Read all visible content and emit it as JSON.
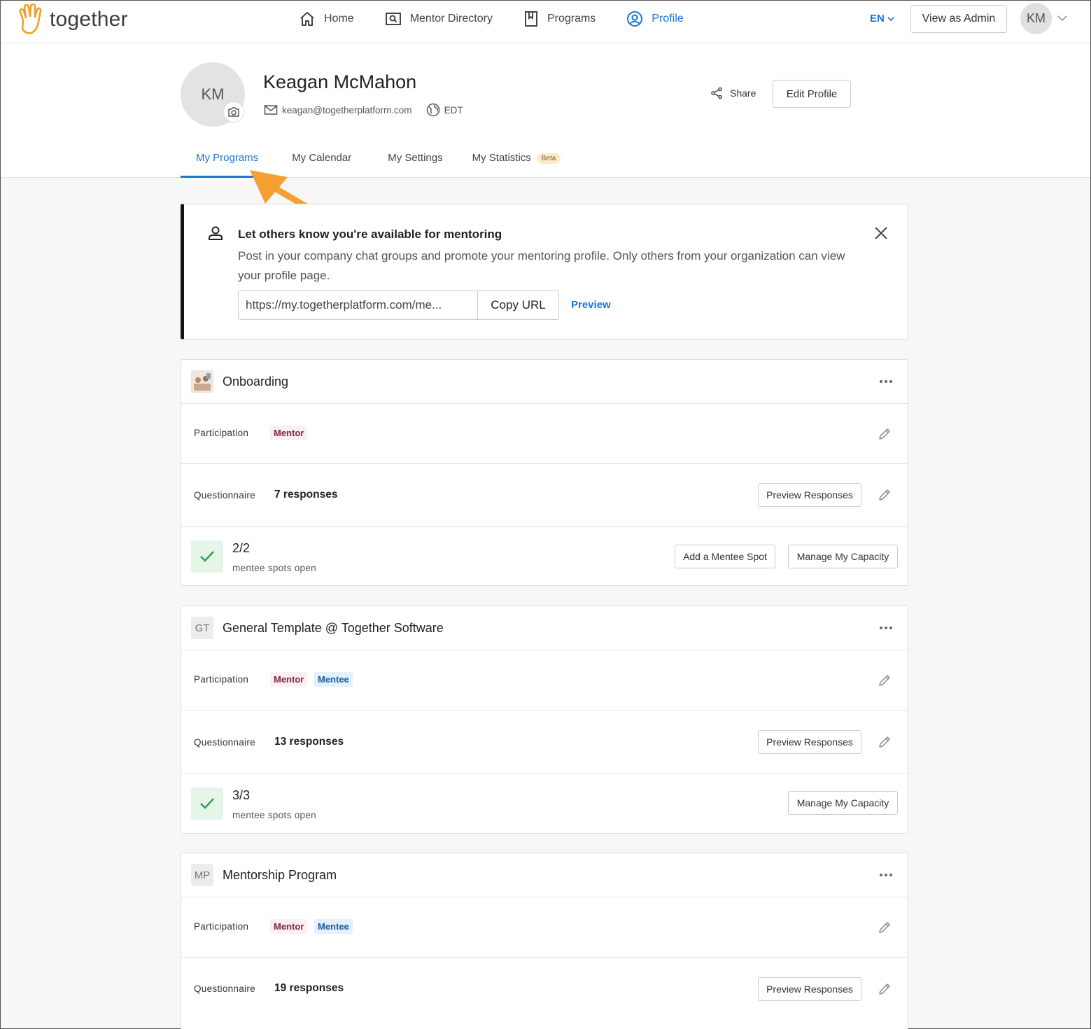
{
  "brand": {
    "name": "together",
    "accent": "#1976d2",
    "logo_color": "#f0a030"
  },
  "nav": {
    "items": [
      {
        "label": "Home",
        "icon": "home-icon",
        "active": false
      },
      {
        "label": "Mentor Directory",
        "icon": "directory-icon",
        "active": false
      },
      {
        "label": "Programs",
        "icon": "bookmark-icon",
        "active": false
      },
      {
        "label": "Profile",
        "icon": "user-circle-icon",
        "active": true
      }
    ],
    "language": "EN",
    "admin_button": "View as Admin",
    "avatar_initials": "KM"
  },
  "profile": {
    "initials": "KM",
    "name": "Keagan McMahon",
    "email": "keagan@togetherplatform.com",
    "timezone": "EDT",
    "share_label": "Share",
    "edit_label": "Edit Profile"
  },
  "tabs": [
    {
      "label": "My Programs",
      "active": true
    },
    {
      "label": "My Calendar",
      "active": false
    },
    {
      "label": "My Settings",
      "active": false
    },
    {
      "label": "My Statistics",
      "active": false,
      "badge": "Beta"
    }
  ],
  "notice": {
    "title": "Let others know you're available for mentoring",
    "text": "Post in your company chat groups and promote your mentoring profile. Only others from your organization can view your profile page.",
    "url_value": "https://my.togetherplatform.com/me...",
    "copy_label": "Copy URL",
    "preview_label": "Preview"
  },
  "programs": [
    {
      "title": "Onboarding",
      "thumb": "",
      "participation_label": "Participation",
      "roles": [
        "Mentor"
      ],
      "questionnaire_label": "Questionnaire",
      "responses": "7 responses",
      "preview_label": "Preview Responses",
      "spots": "2/2",
      "spots_label": "mentee spots open",
      "add_spot_label": "Add a Mentee Spot",
      "capacity_label": "Manage My Capacity"
    },
    {
      "title": "General Template @ Together Software",
      "thumb": "GT",
      "participation_label": "Participation",
      "roles": [
        "Mentor",
        "Mentee"
      ],
      "questionnaire_label": "Questionnaire",
      "responses": "13 responses",
      "preview_label": "Preview Responses",
      "spots": "3/3",
      "spots_label": "mentee spots open",
      "capacity_label": "Manage My Capacity"
    },
    {
      "title": "Mentorship Program",
      "thumb": "MP",
      "participation_label": "Participation",
      "roles": [
        "Mentor",
        "Mentee"
      ],
      "questionnaire_label": "Questionnaire",
      "responses": "19 responses",
      "preview_label": "Preview Responses"
    }
  ]
}
